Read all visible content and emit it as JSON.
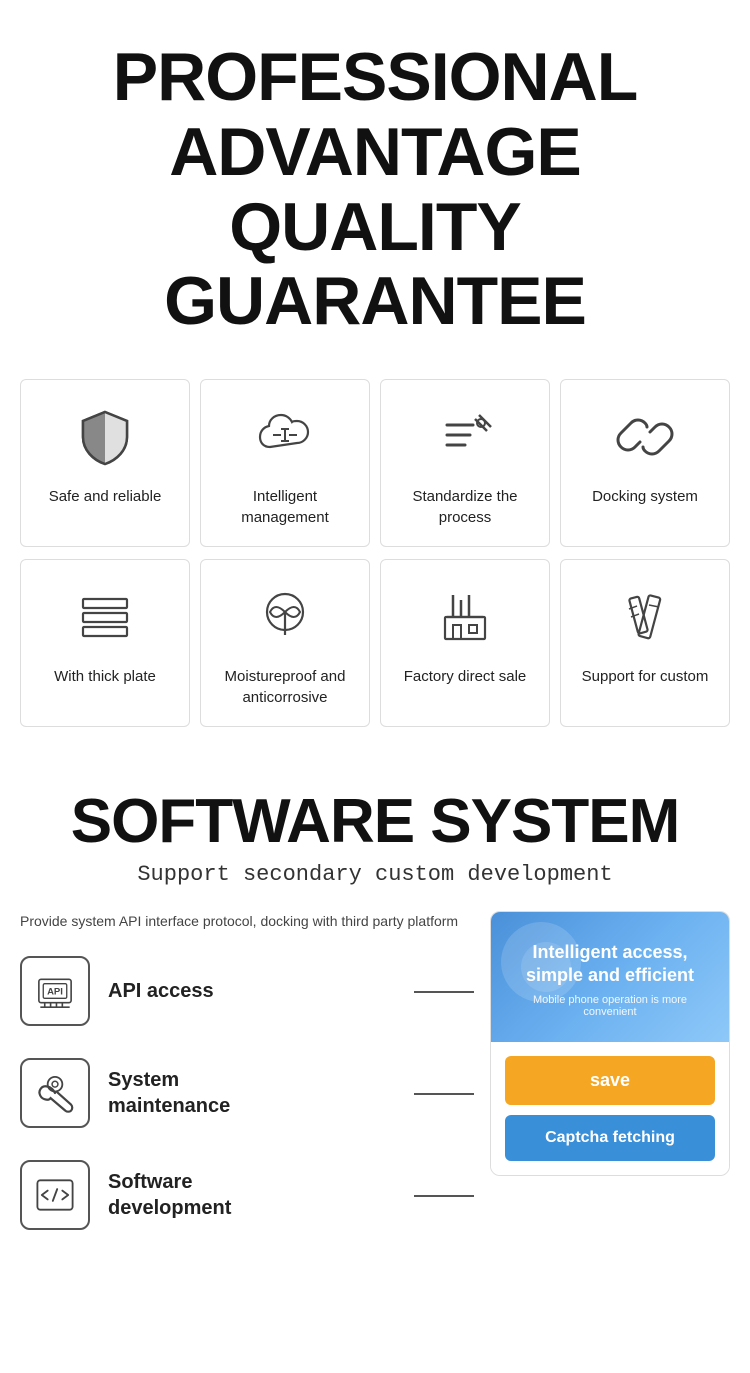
{
  "header": {
    "line1": "PROFESSIONAL",
    "line2": "ADVANTAGE",
    "line3": "QUALITY GUARANTEE"
  },
  "features_row1": [
    {
      "id": "safe-reliable",
      "label": "Safe and reliable",
      "icon": "shield"
    },
    {
      "id": "intelligent-mgmt",
      "label": "Intelligent management",
      "icon": "cloud"
    },
    {
      "id": "standardize",
      "label": "Standardize the process",
      "icon": "checklist"
    },
    {
      "id": "docking",
      "label": "Docking system",
      "icon": "link"
    }
  ],
  "features_row2": [
    {
      "id": "thick-plate",
      "label": "With thick plate",
      "icon": "layers"
    },
    {
      "id": "moistureproof",
      "label": "Moistureproof and anticorrosive",
      "icon": "plant"
    },
    {
      "id": "factory",
      "label": "Factory direct sale",
      "icon": "factory"
    },
    {
      "id": "custom",
      "label": "Support for custom",
      "icon": "pencil-ruler"
    }
  ],
  "software": {
    "title": "SOFTWARE SYSTEM",
    "subtitle": "Support secondary custom development",
    "desc": "Provide system API interface protocol, docking with third party platform",
    "items": [
      {
        "id": "api",
        "label": "API access",
        "icon": "api"
      },
      {
        "id": "maintenance",
        "label": "System\nmaintenance",
        "icon": "wrench"
      },
      {
        "id": "development",
        "label": "Software\ndevelopment",
        "icon": "code"
      }
    ],
    "panel": {
      "main_text": "Intelligent access, simple and efficient",
      "sub_text": "Mobile phone operation is more convenient",
      "btn_save": "save",
      "btn_captcha": "Captcha fetching"
    }
  }
}
